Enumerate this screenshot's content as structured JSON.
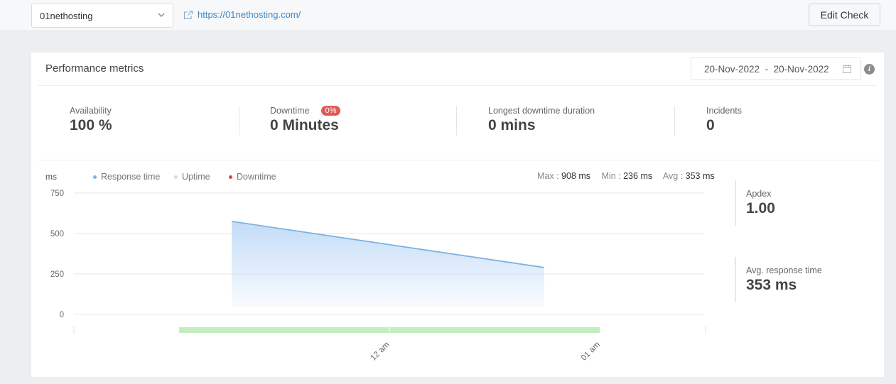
{
  "topbar": {
    "monitor_select": {
      "value": "01nethosting"
    },
    "url_link": "https://01nethosting.com/",
    "edit_button": "Edit Check"
  },
  "card": {
    "title": "Performance metrics",
    "date_range": {
      "from": "20-Nov-2022",
      "separator": "-",
      "to": "20-Nov-2022"
    }
  },
  "stats": {
    "availability": {
      "label": "Availability",
      "value": "100 %"
    },
    "downtime": {
      "label": "Downtime",
      "badge": "0%",
      "value": "0 Minutes"
    },
    "longest_downtime": {
      "label": "Longest downtime duration",
      "value": "0 mins"
    },
    "incidents": {
      "label": "Incidents",
      "value": "0"
    }
  },
  "side_stats": {
    "apdex": {
      "label": "Apdex",
      "value": "1.00"
    },
    "avg_response": {
      "label": "Avg. response time",
      "value": "353 ms"
    }
  },
  "summary": {
    "max_label": "Max :",
    "max_value": "908 ms",
    "min_label": "Min :",
    "min_value": "236 ms",
    "avg_label": "Avg :",
    "avg_value": "353 ms"
  },
  "colors": {
    "response": "#7fb2e0",
    "response_fill": "#c6defa",
    "uptime": "#c2edc0",
    "downtime": "#e0424b",
    "link": "#3d87c4",
    "badge": "#e05a5a"
  },
  "chart_data": {
    "type": "area",
    "ylabel": "ms",
    "ylim": [
      0,
      750
    ],
    "yticks": [
      750,
      500,
      250,
      0
    ],
    "grid": true,
    "legend": [
      "Response time",
      "Uptime",
      "Downtime"
    ],
    "legend_position": "top-left",
    "x_unit": "minutes relative to 12 am",
    "xlim": [
      -90,
      90
    ],
    "xticks": [
      {
        "label": "12 am",
        "x": 0
      },
      {
        "label": "01 am",
        "x": 60
      }
    ],
    "series": [
      {
        "name": "Response time",
        "kind": "line-area",
        "points": [
          {
            "x": -45,
            "y": 575
          },
          {
            "x": 44,
            "y": 290
          }
        ]
      },
      {
        "name": "Uptime",
        "kind": "status-bar",
        "segments": [
          {
            "from": -60,
            "to": 0
          },
          {
            "from": 0,
            "to": 60
          }
        ]
      },
      {
        "name": "Downtime",
        "kind": "status-bar",
        "segments": []
      }
    ]
  }
}
